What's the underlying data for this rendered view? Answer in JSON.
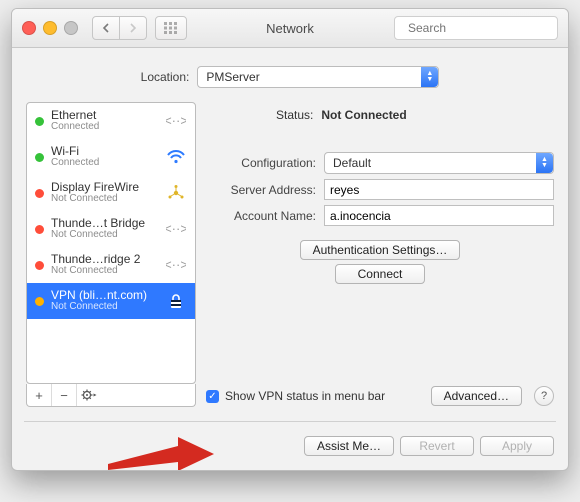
{
  "window_title": "Network",
  "search_placeholder": "Search",
  "location": {
    "label": "Location:",
    "value": "PMServer"
  },
  "sidebar": {
    "items": [
      {
        "name": "Ethernet",
        "status": "Connected",
        "dot": "green",
        "icon": "ethernet"
      },
      {
        "name": "Wi-Fi",
        "status": "Connected",
        "dot": "green",
        "icon": "wifi"
      },
      {
        "name": "Display FireWire",
        "status": "Not Connected",
        "dot": "red",
        "icon": "firewire"
      },
      {
        "name": "Thunde…t Bridge",
        "status": "Not Connected",
        "dot": "red",
        "icon": "thunderbolt"
      },
      {
        "name": "Thunde…ridge 2",
        "status": "Not Connected",
        "dot": "red",
        "icon": "thunderbolt"
      },
      {
        "name": "VPN (bli…nt.com)",
        "status": "Not Connected",
        "dot": "orange",
        "icon": "vpn"
      }
    ]
  },
  "details": {
    "status_label": "Status:",
    "status_value": "Not Connected",
    "config_label": "Configuration:",
    "config_value": "Default",
    "server_label": "Server Address:",
    "server_value": "reyes",
    "account_label": "Account Name:",
    "account_value": "a.inocencia",
    "auth_button": "Authentication Settings…",
    "connect_button": "Connect",
    "show_menubar": "Show VPN status in menu bar",
    "advanced_button": "Advanced…"
  },
  "footer": {
    "assist": "Assist Me…",
    "revert": "Revert",
    "apply": "Apply"
  }
}
